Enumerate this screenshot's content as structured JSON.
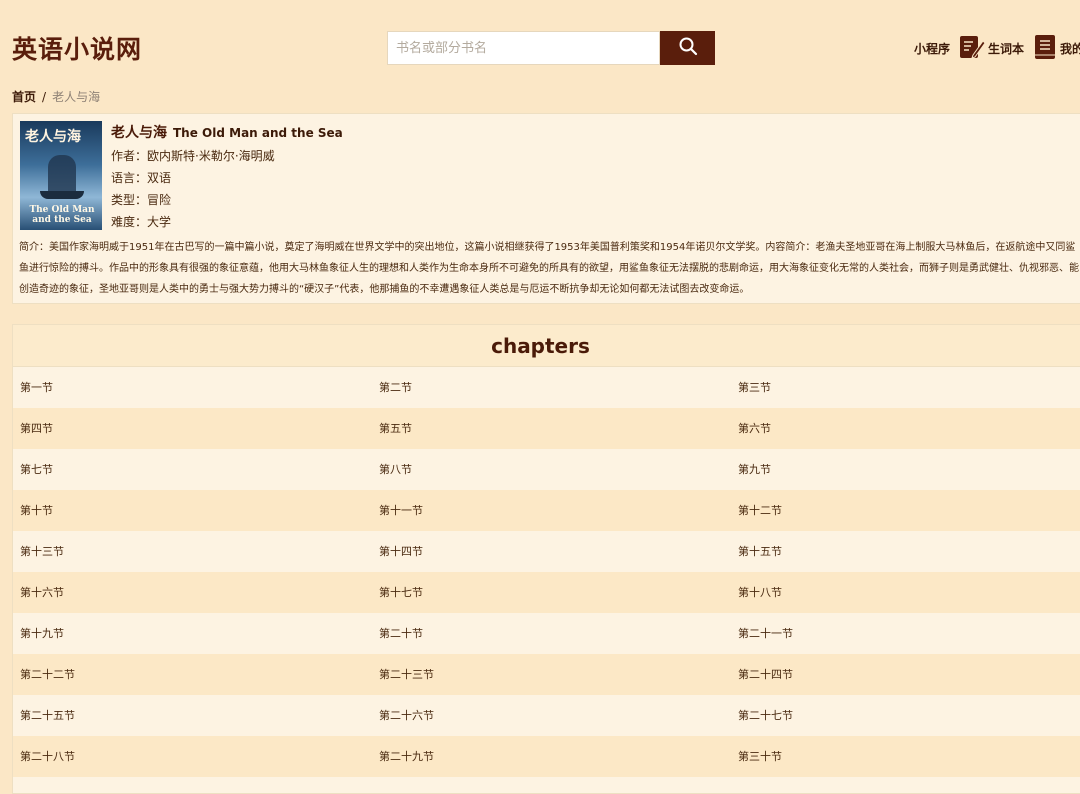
{
  "header": {
    "logo": "英语小说网",
    "search_placeholder": "书名或部分书名",
    "links": [
      "小程序",
      "生词本",
      "我的"
    ]
  },
  "breadcrumb": {
    "home": "首页",
    "separator": "/",
    "current": "老人与海"
  },
  "book": {
    "cover_cn": "老人与海",
    "cover_en": "The Old Man and the Sea",
    "title_cn": "老人与海",
    "title_en": "The Old Man and the Sea",
    "author": "作者：欧内斯特·米勒尔·海明威",
    "language": "语言：双语",
    "genre": "类型：冒险",
    "difficulty": "难度：大学",
    "description": "简介：美国作家海明威于1951年在古巴写的一篇中篇小说，奠定了海明威在世界文学中的突出地位，这篇小说相继获得了1953年美国普利策奖和1954年诺贝尔文学奖。内容简介：老渔夫圣地亚哥在海上制服大马林鱼后，在返航途中又同鲨鱼进行惊险的搏斗。作品中的形象具有很强的象征意蕴，他用大马林鱼象征人生的理想和人类作为生命本身所不可避免的所具有的欲望，用鲨鱼象征无法摆脱的悲剧命运，用大海象征变化无常的人类社会，而狮子则是勇武健壮、仇视邪恶、能创造奇迹的象征，圣地亚哥则是人类中的勇士与强大势力搏斗的“硬汉子”代表，他那捕鱼的不幸遭遇象征人类总是与厄运不断抗争却无论如何都无法试图去改变命运。"
  },
  "chapters": {
    "title": "chapters",
    "rows": [
      [
        "第一节",
        "第二节",
        "第三节"
      ],
      [
        "第四节",
        "第五节",
        "第六节"
      ],
      [
        "第七节",
        "第八节",
        "第九节"
      ],
      [
        "第十节",
        "第十一节",
        "第十二节"
      ],
      [
        "第十三节",
        "第十四节",
        "第十五节"
      ],
      [
        "第十六节",
        "第十七节",
        "第十八节"
      ],
      [
        "第十九节",
        "第二十节",
        "第二十一节"
      ],
      [
        "第二十二节",
        "第二十三节",
        "第二十四节"
      ],
      [
        "第二十五节",
        "第二十六节",
        "第二十七节"
      ],
      [
        "第二十八节",
        "第二十九节",
        "第三十节"
      ]
    ]
  },
  "colors": {
    "background": "#fbe7c6",
    "brand": "#5a1e0c",
    "row_alt": "#fce8c6"
  }
}
